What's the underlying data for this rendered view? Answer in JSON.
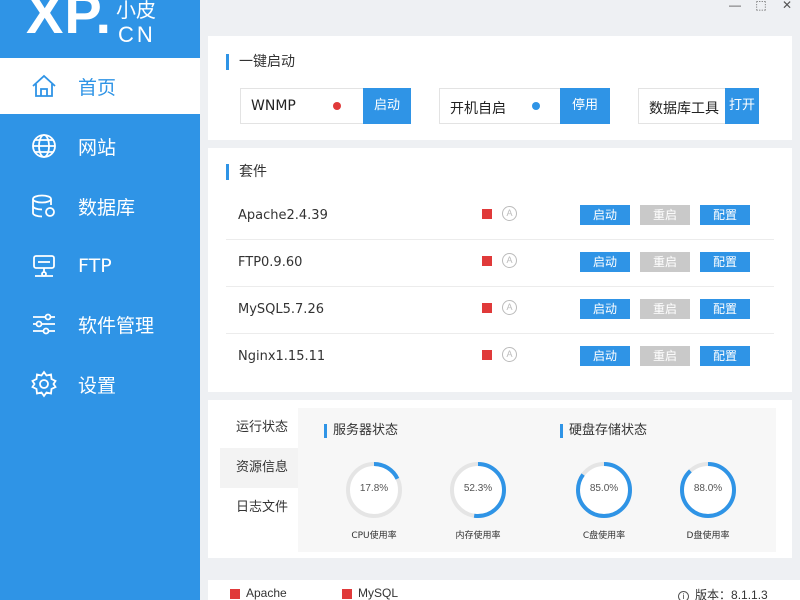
{
  "logo": {
    "text_xp": "XP.",
    "text_cn_top": "小皮",
    "text_cn": "CN"
  },
  "window": {
    "minimize": "—",
    "restore": "⬚",
    "close": "✕"
  },
  "sidebar": {
    "items": [
      {
        "label": "首页",
        "icon": "home-icon"
      },
      {
        "label": "网站",
        "icon": "globe-icon"
      },
      {
        "label": "数据库",
        "icon": "database-icon"
      },
      {
        "label": "FTP",
        "icon": "ftp-icon"
      },
      {
        "label": "软件管理",
        "icon": "sliders-icon"
      },
      {
        "label": "设置",
        "icon": "gear-icon"
      }
    ],
    "active_index": 0
  },
  "quick_start": {
    "title": "一键启动",
    "items": [
      {
        "label": "WNMP",
        "dot_color": "#e03a3a",
        "button": "启动"
      },
      {
        "label": "开机自启",
        "dot_color": "#2f94e6",
        "button": "停用"
      },
      {
        "label": "数据库工具",
        "button": "打开"
      }
    ]
  },
  "suite": {
    "title": "套件",
    "rows": [
      {
        "name": "Apache2.4.39",
        "start": "启动",
        "restart": "重启",
        "config": "配置"
      },
      {
        "name": "FTP0.9.60",
        "start": "启动",
        "restart": "重启",
        "config": "配置"
      },
      {
        "name": "MySQL5.7.26",
        "start": "启动",
        "restart": "重启",
        "config": "配置"
      },
      {
        "name": "Nginx1.15.11",
        "start": "启动",
        "restart": "重启",
        "config": "配置"
      }
    ]
  },
  "status": {
    "tabs": [
      "运行状态",
      "资源信息",
      "日志文件"
    ],
    "active_tab": 1,
    "server_title": "服务器状态",
    "disk_title": "硬盘存储状态",
    "gauges": [
      {
        "value": "17.8%",
        "label": "CPU使用率",
        "fraction": 0.178
      },
      {
        "value": "52.3%",
        "label": "内存使用率",
        "fraction": 0.523
      },
      {
        "value": "85.0%",
        "label": "C盘使用率",
        "fraction": 0.85
      },
      {
        "value": "88.0%",
        "label": "D盘使用率",
        "fraction": 0.88
      }
    ]
  },
  "footer": {
    "items": [
      "Apache",
      "MySQL"
    ],
    "version_label": "版本：",
    "version": "8.1.1.3"
  },
  "colors": {
    "accent": "#2f94e6",
    "stopped": "#e03a3a",
    "gray_button": "#c9c9c9"
  }
}
